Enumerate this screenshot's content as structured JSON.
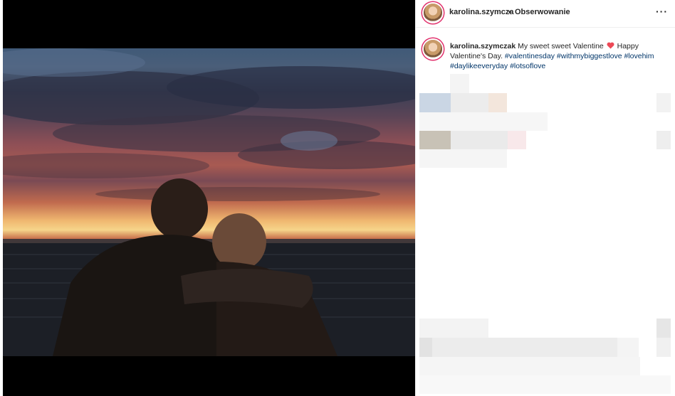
{
  "post": {
    "username": "karolina.szymcza",
    "follow_separator": "•",
    "follow_label": "Obserwowanie",
    "more_icon": "more-icon",
    "image_icon": "photo"
  },
  "caption": {
    "username": "karolina.szymczak",
    "text_before_heart": "My sweet sweet Valentine",
    "heart_icon": "red-heart-icon",
    "text_after_heart": "Happy Valentine's Day.",
    "hashtags": [
      "#valentinesday",
      "#withmybiggestlove",
      "#lovehim",
      "#daylikeeveryday",
      "#lotsoflove"
    ]
  },
  "colors": {
    "accent_ring": "#e1306c",
    "hashtag": "#003569",
    "text": "#262626",
    "heart": "#ed4956"
  }
}
